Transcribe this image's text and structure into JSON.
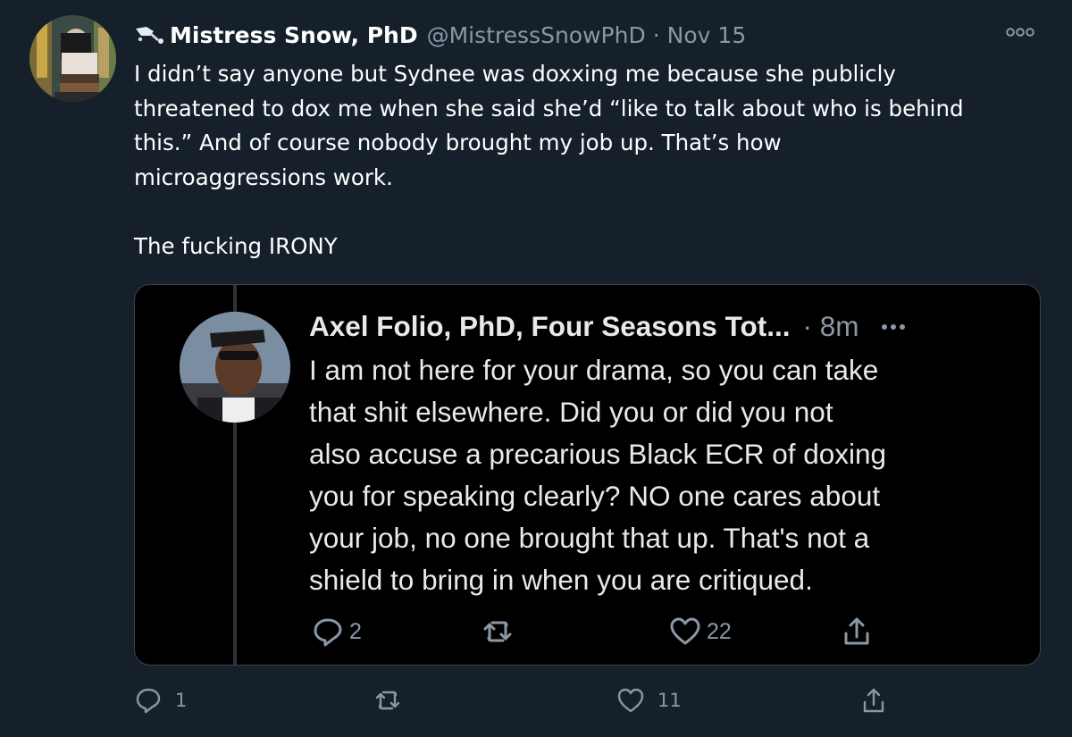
{
  "tweet": {
    "author_name": "Mistress Snow, PhD",
    "handle": "@MistressSnowPhD",
    "separator": "·",
    "time": "Nov 15",
    "text": "I didn’t say anyone but Sydnee was doxxing me because she publicly\nthreatened to dox me when she said she’d “like to talk about who is behind\nthis.” And of course nobody brought my job up. That’s how\nmicroaggressions work.\n\nThe fucking IRONY",
    "actions": {
      "reply_count": "1",
      "retweet_count": "",
      "like_count": "11"
    }
  },
  "quoted": {
    "author_name": "Axel Folio, PhD, Four Seasons Tot...",
    "time": "· 8m",
    "text": "I am not here for your drama, so you can take\nthat shit elsewhere. Did you or did you not\nalso accuse a precarious Black ECR of doxing\nyou for speaking clearly? NO one cares about\nyour job, no one brought that up. That's not a\nshield to bring in when you are critiqued.",
    "actions": {
      "reply_count": "2",
      "retweet_count": "",
      "like_count": "22"
    }
  },
  "icons": {
    "name_prefix": "sword-icon",
    "more": "more-dots-icon",
    "reply": "reply-icon",
    "retweet": "retweet-icon",
    "like": "heart-icon",
    "share": "share-icon"
  },
  "colors": {
    "background": "#15202b",
    "secondary_text": "#8899a6",
    "quote_background": "#000000",
    "border": "#38444d"
  }
}
